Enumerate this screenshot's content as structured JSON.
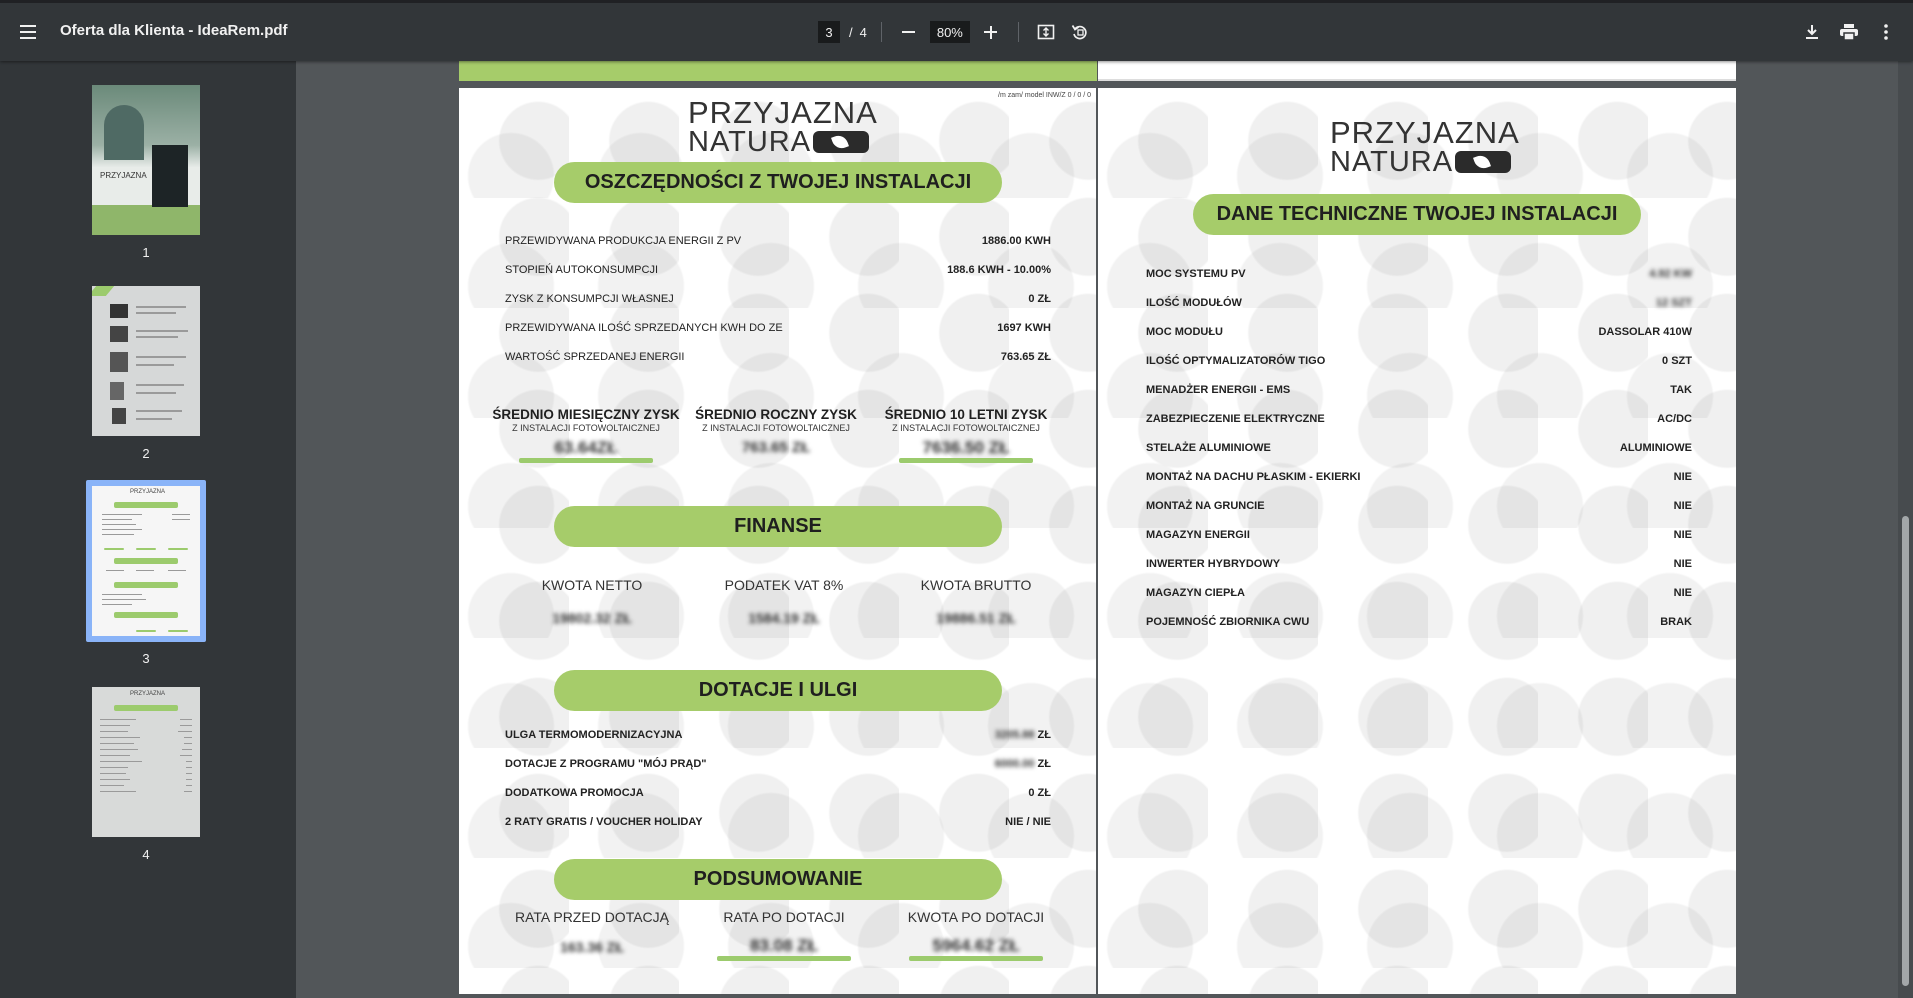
{
  "toolbar": {
    "title": "Oferta dla Klienta - IdeaRem.pdf",
    "current_page": "3",
    "total_pages": "4",
    "slash": "/",
    "zoom": "80%"
  },
  "sidebar": {
    "thumbnails": [
      {
        "label": "1"
      },
      {
        "label": "2"
      },
      {
        "label": "3",
        "selected": true
      },
      {
        "label": "4"
      }
    ]
  },
  "page3": {
    "disclaimer": "/m zam/ model INW/Z 0 / 0 / 0",
    "logo_line1": "PRZYJAZNA",
    "logo_line2": "NATURA",
    "savings_heading": "OSZCZĘDNOŚCI Z TWOJEJ INSTALACJI",
    "savings_rows": [
      {
        "label": "PRZEWIDYWANA PRODUKCJA ENERGII Z PV",
        "value": "1886.00 KWH"
      },
      {
        "label": "STOPIEŃ AUTOKONSUMPCJI",
        "value": "188.6 KWH - 10.00%"
      },
      {
        "label": "ZYSK Z KONSUMPCJI WŁASNEJ",
        "value": "0 ZŁ"
      },
      {
        "label": "PRZEWIDYWANA ILOŚĆ SPRZEDANYCH KWH DO ZE",
        "value": "1697 KWH"
      },
      {
        "label": "WARTOŚĆ SPRZEDANEJ ENERGII",
        "value": "763.65 ZŁ"
      }
    ],
    "stats": [
      {
        "title": "ŚREDNIO MIESIĘCZNY ZYSK",
        "sub": "Z INSTALACJI FOTOWOLTAICZNEJ",
        "value": "63.64ZŁ"
      },
      {
        "title": "ŚREDNIO ROCZNY ZYSK",
        "sub": "Z INSTALACJI FOTOWOLTAICZNEJ",
        "value": "763.65 ZŁ"
      },
      {
        "title": "ŚREDNIO 10 LETNI ZYSK",
        "sub": "Z INSTALACJI FOTOWOLTAICZNEJ",
        "value": "7636.50 ZŁ"
      }
    ],
    "finance_heading": "FINANSE",
    "finance": [
      {
        "label": "KWOTA NETTO",
        "value": "19802.32 ZŁ"
      },
      {
        "label": "PODATEK VAT 8%",
        "value": "1584.19 ZŁ"
      },
      {
        "label": "KWOTA BRUTTO",
        "value": "19886.51 ZŁ"
      }
    ],
    "dotacje_heading": "DOTACJE I ULGI",
    "dotacje_rows": [
      {
        "label": "ULGA TERMOMODERNIZACYJNA",
        "value_hidden": "3205.88",
        "unit": "ZŁ"
      },
      {
        "label": "DOTACJE Z PROGRAMU \"MÓJ PRĄD\"",
        "value_hidden": "6000.00",
        "unit": "ZŁ"
      },
      {
        "label": "DODATKOWA PROMOCJA",
        "value": "0 ZŁ"
      },
      {
        "label": "2 RATY GRATIS / VOUCHER HOLIDAY",
        "value": "NIE / NIE"
      }
    ],
    "summary_heading": "PODSUMOWANIE",
    "summary": [
      {
        "label": "RATA PRZED DOTACJĄ",
        "value": "163.36 ZŁ"
      },
      {
        "label": "RATA PO DOTACJI",
        "value": "83.08 ZŁ"
      },
      {
        "label": "KWOTA PO DOTACJI",
        "value": "5964.62 ZŁ"
      }
    ]
  },
  "page4": {
    "logo_line1": "PRZYJAZNA",
    "logo_line2": "NATURA",
    "heading": "DANE TECHNICZNE TWOJEJ INSTALACJI",
    "rows": [
      {
        "label": "MOC SYSTEMU PV",
        "value": "4.92 KW",
        "hidden": true
      },
      {
        "label": "ILOŚĆ MODUŁÓW",
        "value": "12 SZT",
        "hidden": true
      },
      {
        "label": "MOC MODUŁU",
        "value": "DASSOLAR 410W"
      },
      {
        "label": "ILOŚĆ OPTYMALIZATORÓW TIGO",
        "value": "0 SZT"
      },
      {
        "label": "MENADŻER ENERGII - EMS",
        "value": "TAK"
      },
      {
        "label": "ZABEZPIECZENIE ELEKTRYCZNE",
        "value": "AC/DC"
      },
      {
        "label": "STELAŻE ALUMINIOWE",
        "value": "ALUMINIOWE"
      },
      {
        "label": "MONTAŻ NA DACHU PŁASKIM - EKIERKI",
        "value": "NIE"
      },
      {
        "label": "MONTAŻ NA GRUNCIE",
        "value": "NIE"
      },
      {
        "label": "MAGAZYN ENERGII",
        "value": "NIE"
      },
      {
        "label": "INWERTER HYBRYDOWY",
        "value": "NIE"
      },
      {
        "label": "MAGAZYN CIEPŁA",
        "value": "NIE"
      },
      {
        "label": "POJEMNOŚĆ ZBIORNIKA CWU",
        "value": "BRAK"
      }
    ]
  },
  "colors": {
    "accent_green": "#a6cc6a",
    "toolbar": "#323639",
    "viewer_bg": "#525659",
    "selected": "#8ab4f8"
  }
}
